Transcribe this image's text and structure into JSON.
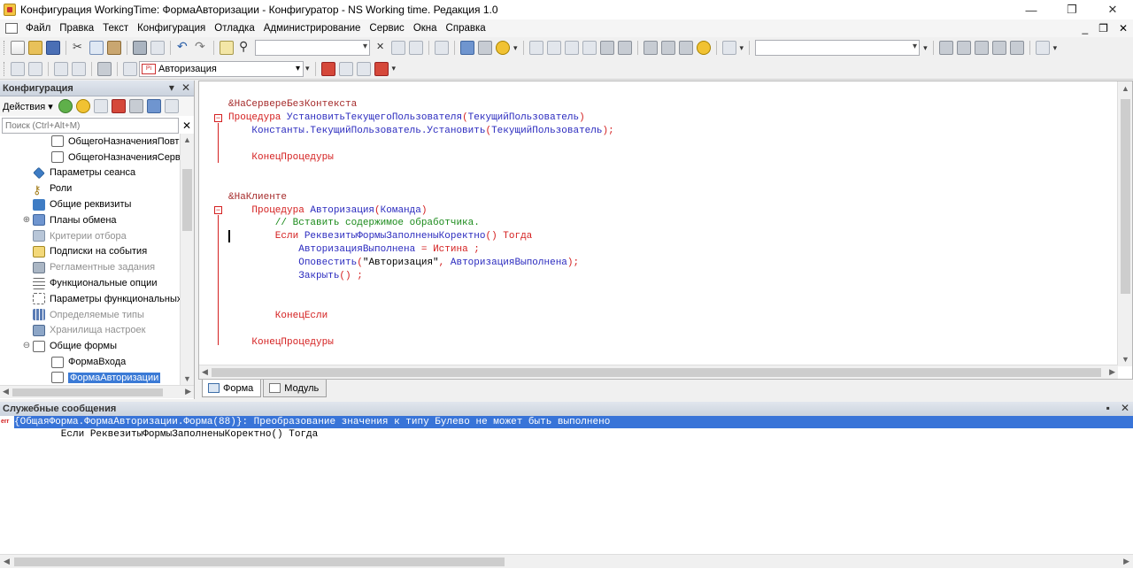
{
  "window": {
    "title": "Конфигурация WorkingTime: ФормаАвторизации - Конфигуратор - NS Working time. Редакция 1.0",
    "minimize": "—",
    "maximize": "❐",
    "close": "✕"
  },
  "menu": {
    "items": [
      "Файл",
      "Правка",
      "Текст",
      "Конфигурация",
      "Отладка",
      "Администрирование",
      "Сервис",
      "Окна",
      "Справка"
    ],
    "mdi_min": "_",
    "mdi_restore": "❐",
    "mdi_close": "✕"
  },
  "toolbar2": {
    "form_select": "Авторизация",
    "form_select_icon": "Pi"
  },
  "config_panel": {
    "title": "Конфигурация",
    "pin": "▾",
    "close": "✕",
    "actions_label": "Действия ▾",
    "search_placeholder": "Поиск (Ctrl+Alt+M)",
    "search_clear": "✕",
    "tree": [
      {
        "label": "ОбщегоНазначенияПовтИ",
        "icon": "form",
        "indent": 1,
        "expander": "",
        "state": "normal"
      },
      {
        "label": "ОбщегоНазначенияСерве",
        "icon": "form",
        "indent": 1,
        "expander": "",
        "state": "normal"
      },
      {
        "label": "Параметры сеанса",
        "icon": "blue",
        "indent": 0,
        "expander": "",
        "state": "normal"
      },
      {
        "label": "Роли",
        "icon": "key",
        "indent": 0,
        "expander": "",
        "state": "normal"
      },
      {
        "label": "Общие реквизиты",
        "icon": "bar",
        "indent": 0,
        "expander": "",
        "state": "normal"
      },
      {
        "label": "Планы обмена",
        "icon": "exch",
        "indent": 0,
        "expander": "⊕",
        "state": "normal"
      },
      {
        "label": "Критерии отбора",
        "icon": "filter",
        "indent": 0,
        "expander": "",
        "state": "gray"
      },
      {
        "label": "Подписки на события",
        "icon": "pencil",
        "indent": 0,
        "expander": "",
        "state": "normal"
      },
      {
        "label": "Регламентные задания",
        "icon": "gear",
        "indent": 0,
        "expander": "",
        "state": "gray"
      },
      {
        "label": "Функциональные опции",
        "icon": "list",
        "indent": 0,
        "expander": "",
        "state": "normal"
      },
      {
        "label": "Параметры функциональных",
        "icon": "dots",
        "indent": 0,
        "expander": "",
        "state": "normal"
      },
      {
        "label": "Определяемые типы",
        "icon": "grid",
        "indent": 0,
        "expander": "",
        "state": "gray"
      },
      {
        "label": "Хранилища настроек",
        "icon": "store",
        "indent": 0,
        "expander": "",
        "state": "gray"
      },
      {
        "label": "Общие формы",
        "icon": "form",
        "indent": 0,
        "expander": "⊖",
        "state": "normal"
      },
      {
        "label": "ФормаВхода",
        "icon": "form",
        "indent": 1,
        "expander": "",
        "state": "normal"
      },
      {
        "label": "ФормаАвторизации",
        "icon": "form",
        "indent": 1,
        "expander": "",
        "state": "sel"
      }
    ]
  },
  "editor": {
    "lines": [
      [
        {
          "t": "&НаСервереБезКонтекста",
          "c": "dir"
        }
      ],
      [
        {
          "t": "Процедура ",
          "c": "kw"
        },
        {
          "t": "УстановитьТекущегоПользователя",
          "c": "id"
        },
        {
          "t": "(",
          "c": "kw"
        },
        {
          "t": "ТекущийПользователь",
          "c": "id"
        },
        {
          "t": ")",
          "c": "kw"
        }
      ],
      [
        {
          "t": "    Константы.ТекущийПользователь.Установить",
          "c": "id"
        },
        {
          "t": "(",
          "c": "kw"
        },
        {
          "t": "ТекущийПользователь",
          "c": "id"
        },
        {
          "t": ");",
          "c": "kw"
        }
      ],
      [
        {
          "t": "",
          "c": "id"
        }
      ],
      [
        {
          "t": "    КонецПроцедуры",
          "c": "kw"
        }
      ],
      [
        {
          "t": "",
          "c": "id"
        }
      ],
      [
        {
          "t": "",
          "c": "id"
        }
      ],
      [
        {
          "t": "&НаКлиенте",
          "c": "dir"
        }
      ],
      [
        {
          "t": "    Процедура ",
          "c": "kw"
        },
        {
          "t": "Авторизация",
          "c": "id"
        },
        {
          "t": "(",
          "c": "kw"
        },
        {
          "t": "Команда",
          "c": "id"
        },
        {
          "t": ")",
          "c": "kw"
        }
      ],
      [
        {
          "t": "        // Вставить содержимое обработчика.",
          "c": "cm"
        }
      ],
      [
        {
          "t": "        Если ",
          "c": "kw"
        },
        {
          "t": "РеквезитыФормыЗаполненыКоректно",
          "c": "id"
        },
        {
          "t": "() ",
          "c": "kw"
        },
        {
          "t": "Тогда",
          "c": "kw"
        }
      ],
      [
        {
          "t": "            ",
          "c": "id"
        },
        {
          "t": "АвторизацияВыполнена",
          "c": "id"
        },
        {
          "t": " = ",
          "c": "kw"
        },
        {
          "t": "Истина",
          "c": "kw"
        },
        {
          "t": " ;",
          "c": "kw"
        }
      ],
      [
        {
          "t": "            Оповестить",
          "c": "id"
        },
        {
          "t": "(",
          "c": "kw"
        },
        {
          "t": "\"Авторизация\"",
          "c": "str"
        },
        {
          "t": ", ",
          "c": "kw"
        },
        {
          "t": "АвторизацияВыполнена",
          "c": "id"
        },
        {
          "t": ");",
          "c": "kw"
        }
      ],
      [
        {
          "t": "            Закрыть",
          "c": "id"
        },
        {
          "t": "() ;",
          "c": "kw"
        }
      ],
      [
        {
          "t": "",
          "c": "id"
        }
      ],
      [
        {
          "t": "",
          "c": "id"
        }
      ],
      [
        {
          "t": "        КонецЕсли",
          "c": "kw"
        }
      ],
      [
        {
          "t": "",
          "c": "id"
        }
      ],
      [
        {
          "t": "    КонецПроцедуры",
          "c": "kw"
        }
      ]
    ]
  },
  "tabs": [
    {
      "label": "Форма",
      "icon": "form",
      "active": true
    },
    {
      "label": "Модуль",
      "icon": "mod",
      "active": false
    }
  ],
  "messages": {
    "title": "Служебные сообщения",
    "pin": "▪",
    "close": "✕",
    "err_tag": "err",
    "error_text": "{ОбщаяФорма.ФормаАвторизации.Форма(88)}: Преобразование значения к типу Булево не может быть выполнено",
    "cont_text": "        Если РеквезитыФормыЗаполненыКоректно() Тогда"
  },
  "colors": {
    "keyword": "#d42020",
    "identifier": "#2b2bbf",
    "comment": "#1a8a1a",
    "selection": "#3874d8"
  }
}
